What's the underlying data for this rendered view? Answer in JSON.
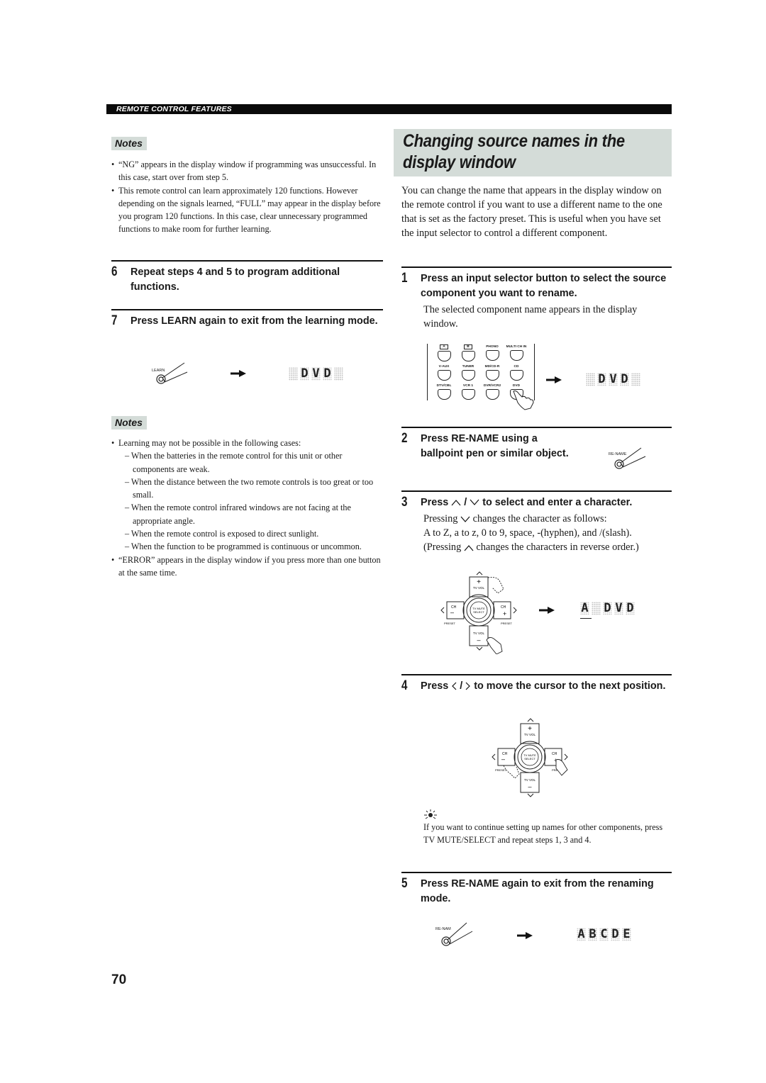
{
  "header": {
    "section_label": "REMOTE CONTROL FEATURES"
  },
  "left": {
    "notes1": {
      "tag": "Notes",
      "items": [
        "“NG” appears in the display window if programming was unsuccessful. In this case, start over from step 5.",
        "This remote control can learn approximately 120 functions. However depending on the signals learned, “FULL” may appear in the display before you program 120 functions. In this case, clear unnecessary programmed functions to make room for further learning."
      ]
    },
    "steps": [
      {
        "num": "6",
        "text": "Repeat steps 4 and 5 to program additional functions."
      },
      {
        "num": "7",
        "text": "Press LEARN again to exit from the learning mode."
      }
    ],
    "learn_illustration": {
      "button_label": "LEARN",
      "display_chars": [
        "",
        "D",
        "V",
        "D",
        ""
      ]
    },
    "notes2": {
      "tag": "Notes",
      "intro": "Learning may not be possible in the following cases:",
      "cases": [
        "– When the batteries in the remote control for this unit or other components are weak.",
        "– When the distance between the two remote controls is too great or too small.",
        "– When the remote control infrared windows are not facing at the appropriate angle.",
        "– When the remote control is exposed to direct sunlight.",
        "– When the function to be programmed is continuous or uncommon."
      ],
      "last": "“ERROR” appears in the display window if you press more than one button at the same time."
    }
  },
  "right": {
    "title_line1": "Changing source names in the",
    "title_line2": "display window",
    "intro": "You can change the name that appears in the display window on the remote control if you want to use a different name to the one that is set as the factory preset. This is useful when you have set the input selector to control a different component.",
    "step1": {
      "num": "1",
      "text": "Press an input selector button to select the source component you want to rename.",
      "body": "The selected component name appears in the display window.",
      "buttons": [
        "A",
        "B",
        "PHONO",
        "MULTI CH IN",
        "V-AUX",
        "TUNER",
        "MD/CD-R",
        "CD",
        "DTV/CBL",
        "VCR 1",
        "DVR/VCR2",
        "DVD"
      ],
      "display_chars": [
        "",
        "D",
        "V",
        "D",
        ""
      ]
    },
    "step2": {
      "num": "2",
      "text": "Press RE-NAME using a ballpoint pen or similar object.",
      "button_label": "RE-NAME"
    },
    "step3": {
      "num": "3",
      "text_before": "Press",
      "text_after": "to select and enter a character.",
      "line1_before": "Pressing",
      "line1_after": "changes the character as follows:",
      "line2": "A to Z, a to z, 0 to 9, space, -(hyphen), and /(slash).",
      "line3_before": "(Pressing",
      "line3_after": "changes the characters in reverse order.)",
      "display_chars": [
        "A",
        "",
        "D",
        "V",
        "D"
      ]
    },
    "step4": {
      "num": "4",
      "text_before": "Press",
      "text_after": "to move the cursor to the next position."
    },
    "dpad": {
      "tv_vol": "TV VOL",
      "ch": "CH",
      "preset": "PRESET",
      "mute_line1": "TV MUTE",
      "mute_line2": "SELECT"
    },
    "tip": {
      "icon": "hint-icon",
      "text": "If you want to continue setting up names for other components, press TV MUTE/SELECT and repeat steps 1, 3 and 4."
    },
    "step5": {
      "num": "5",
      "text": "Press RE-NAME again to exit from the renaming mode.",
      "button_label": "RE-NAM",
      "display_chars": [
        "A",
        "B",
        "C",
        "D",
        "E"
      ]
    }
  },
  "page_number": "70"
}
